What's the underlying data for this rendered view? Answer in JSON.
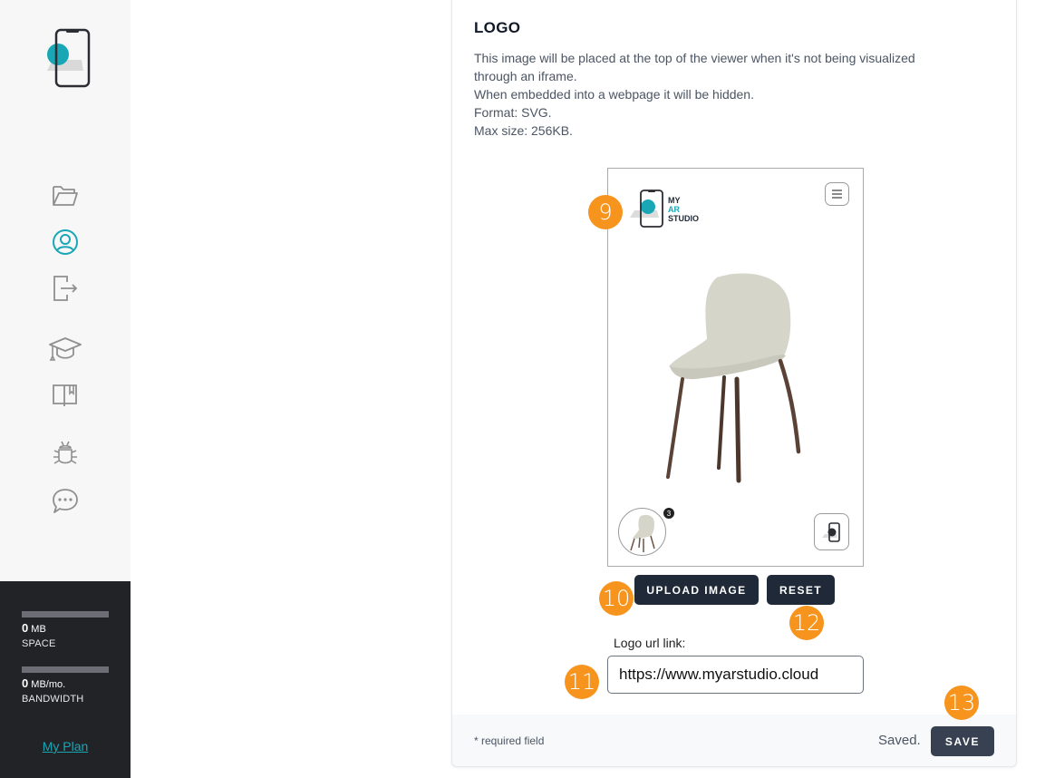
{
  "sidebar": {
    "logo_icon": "phone-ar-logo-icon",
    "nav": [
      {
        "name": "projects",
        "icon": "folder-icon",
        "active": false
      },
      {
        "name": "account",
        "icon": "user-circle-icon",
        "active": true
      },
      {
        "name": "logout",
        "icon": "logout-icon",
        "active": false
      },
      {
        "name": "academy",
        "icon": "graduation-cap-icon",
        "active": false
      },
      {
        "name": "docs",
        "icon": "book-icon",
        "active": false
      },
      {
        "name": "report-bug",
        "icon": "bug-icon",
        "active": false
      },
      {
        "name": "support-chat",
        "icon": "chat-icon",
        "active": false
      }
    ],
    "plan": {
      "space_value": "0",
      "space_unit": "MB",
      "space_label": "SPACE",
      "space_usage": 0,
      "bandwidth_value": "0",
      "bandwidth_unit": "MB/mo.",
      "bandwidth_label": "BANDWIDTH",
      "bandwidth_usage": 0,
      "link_label": "My Plan"
    }
  },
  "colors": {
    "accent": "#19a7b6",
    "badge": "#f7941d",
    "button": "#1f2937"
  },
  "logo_section": {
    "title": "LOGO",
    "description": [
      "This image will be placed at the top of the viewer when it's not being visualized",
      "through an iframe.",
      "When embedded into a webpage it will be hidden.",
      "Format: SVG.",
      "Max size: 256KB."
    ],
    "preview": {
      "brand_line1": "MY",
      "brand_line2": "AR",
      "brand_line3": "STUDIO",
      "thumbnail_count": "3"
    },
    "upload_label": "UPLOAD IMAGE",
    "reset_label": "RESET",
    "url_label": "Logo url link:",
    "url_value": "https://www.myarstudio.cloud"
  },
  "badges": [
    "9",
    "10",
    "11",
    "12",
    "13"
  ],
  "footer": {
    "required_note": "* required field",
    "status": "Saved.",
    "save_label": "SAVE"
  }
}
